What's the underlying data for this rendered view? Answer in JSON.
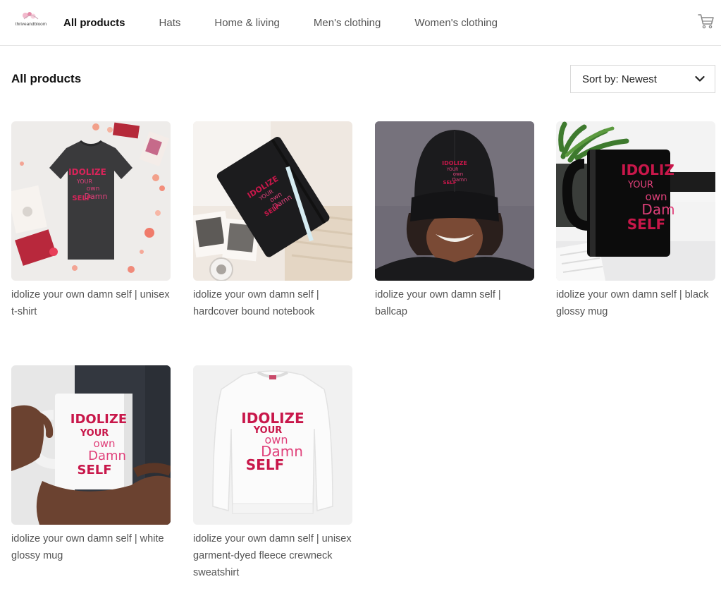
{
  "store": {
    "logo_text": "thriveandbloom"
  },
  "nav": {
    "items": [
      {
        "label": "All products",
        "active": true
      },
      {
        "label": "Hats",
        "active": false
      },
      {
        "label": "Home & living",
        "active": false
      },
      {
        "label": "Men's clothing",
        "active": false
      },
      {
        "label": "Women's clothing",
        "active": false
      }
    ],
    "cart_icon": "shopping-cart-icon"
  },
  "page": {
    "title": "All products",
    "sort_label": "Sort by: Newest"
  },
  "products": [
    {
      "title": "idolize your own damn self | unisex t-shirt",
      "image_text": [
        "IDOLIZE",
        "YOUR",
        "own",
        "Damn",
        "SELF"
      ]
    },
    {
      "title": "idolize your own damn self | hardcover bound notebook",
      "image_text": [
        "IDOLIZE",
        "YOUR",
        "own",
        "Damn",
        "SELF"
      ]
    },
    {
      "title": "idolize your own damn self | ballcap",
      "image_text": [
        "IDOLIZE",
        "YOUR",
        "own",
        "Damn",
        "SELF"
      ]
    },
    {
      "title": "idolize your own damn self | black glossy mug",
      "image_text": [
        "IDOLIZ",
        "YOUR",
        "own",
        "Dam",
        "SELF"
      ]
    },
    {
      "title": "idolize your own damn self | white glossy mug",
      "image_text": [
        "IDOLIZE",
        "YOUR",
        "own",
        "Damn",
        "SELF"
      ]
    },
    {
      "title": "idolize your own damn self | unisex garment-dyed fleece crewneck sweatshirt",
      "image_text": [
        "IDOLIZE",
        "YOUR",
        "own",
        "Damn",
        "SELF"
      ]
    }
  ],
  "colors": {
    "print_red": "#c8174a",
    "print_pink": "#e0407a"
  }
}
